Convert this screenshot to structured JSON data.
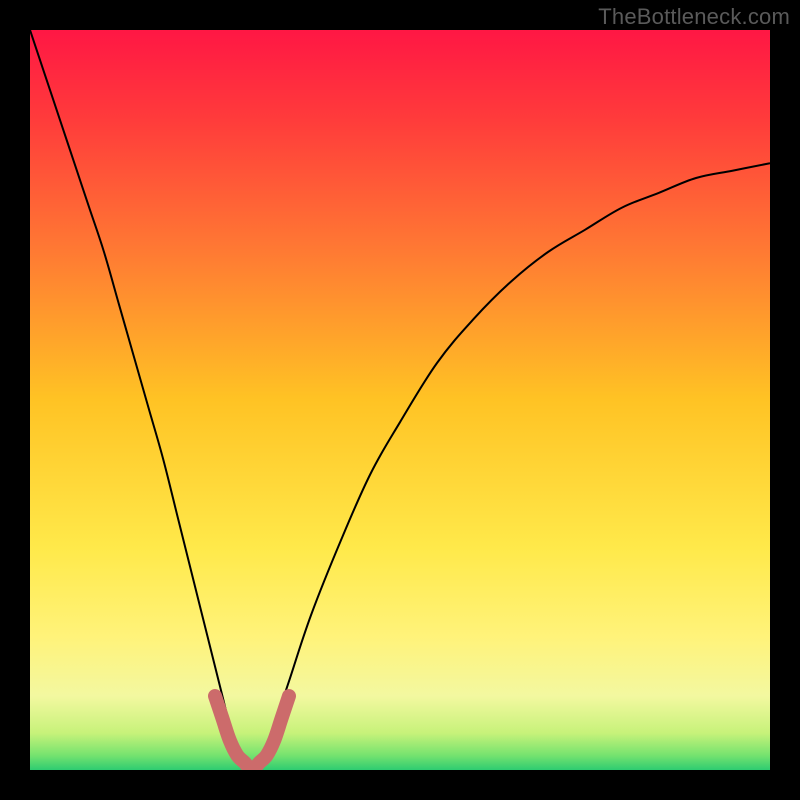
{
  "watermark": "TheBottleneck.com",
  "chart_data": {
    "type": "line",
    "title": "",
    "xlabel": "",
    "ylabel": "",
    "xlim": [
      0,
      100
    ],
    "ylim": [
      0,
      100
    ],
    "grid": false,
    "legend": false,
    "background": {
      "type": "vertical-gradient",
      "stops": [
        {
          "pos": 0.0,
          "color": "#ff1744"
        },
        {
          "pos": 0.12,
          "color": "#ff3b3b"
        },
        {
          "pos": 0.3,
          "color": "#ff7a33"
        },
        {
          "pos": 0.5,
          "color": "#ffc324"
        },
        {
          "pos": 0.7,
          "color": "#ffe94a"
        },
        {
          "pos": 0.82,
          "color": "#fff37a"
        },
        {
          "pos": 0.9,
          "color": "#f3f8a0"
        },
        {
          "pos": 0.95,
          "color": "#c7f27a"
        },
        {
          "pos": 0.98,
          "color": "#76e36f"
        },
        {
          "pos": 1.0,
          "color": "#2ecc71"
        }
      ]
    },
    "series": [
      {
        "name": "curve",
        "color": "#000000",
        "stroke_width": 2,
        "x": [
          0,
          2,
          4,
          6,
          8,
          10,
          12,
          14,
          16,
          18,
          20,
          22,
          24,
          26,
          27,
          28,
          29,
          30,
          31,
          32,
          33,
          35,
          38,
          42,
          46,
          50,
          55,
          60,
          65,
          70,
          75,
          80,
          85,
          90,
          95,
          100
        ],
        "values": [
          100,
          94,
          88,
          82,
          76,
          70,
          63,
          56,
          49,
          42,
          34,
          26,
          18,
          10,
          6,
          3,
          1,
          0,
          1,
          3,
          6,
          12,
          21,
          31,
          40,
          47,
          55,
          61,
          66,
          70,
          73,
          76,
          78,
          80,
          81,
          82
        ]
      },
      {
        "name": "highlight",
        "color": "#cc6b6b",
        "stroke_width": 14,
        "linecap": "round",
        "x": [
          25,
          26,
          27,
          28,
          29,
          30,
          31,
          32,
          33,
          34,
          35
        ],
        "values": [
          10,
          7,
          4,
          2,
          1,
          0,
          1,
          2,
          4,
          7,
          10
        ]
      }
    ]
  }
}
